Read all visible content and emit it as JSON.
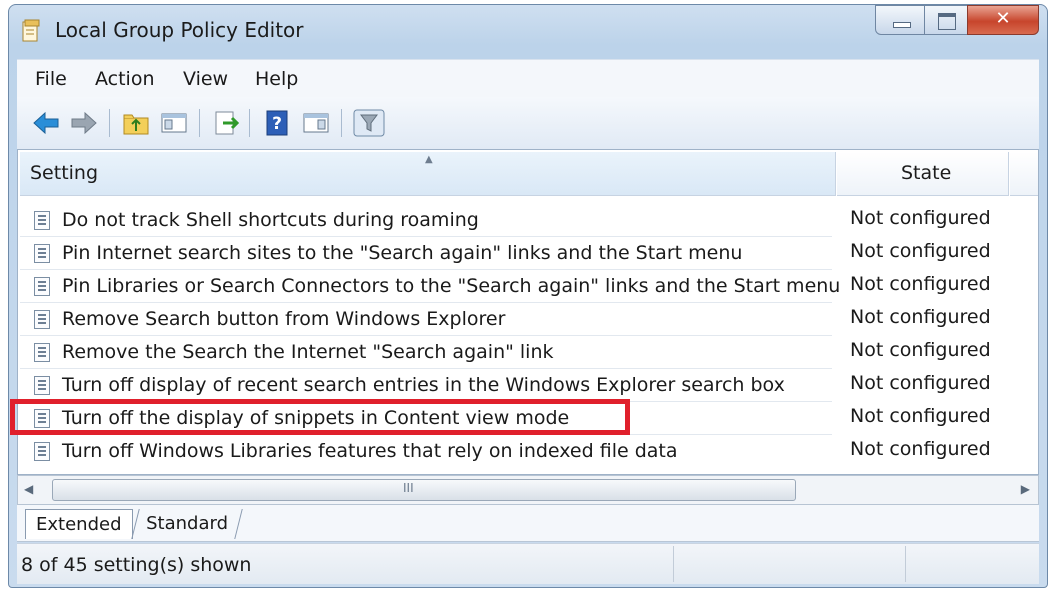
{
  "window": {
    "title": "Local Group Policy Editor",
    "caption_buttons": [
      "minimize-icon",
      "maximize-icon",
      "close-icon"
    ]
  },
  "menu": [
    "File",
    "Action",
    "View",
    "Help"
  ],
  "toolbar": {
    "buttons": [
      "back-arrow-icon",
      "forward-arrow-icon",
      "up-folder-icon",
      "show-hide-console-tree-icon",
      "export-list-icon",
      "help-icon",
      "show-hide-action-pane-icon",
      "filter-icon"
    ]
  },
  "table": {
    "columns": [
      "Setting",
      "State"
    ],
    "rows": [
      {
        "name": "Do not track Shell shortcuts during roaming",
        "state": "Not configured"
      },
      {
        "name": "Pin Internet search sites to the \"Search again\" links and the Start menu",
        "state": "Not configured"
      },
      {
        "name": "Pin Libraries or Search Connectors to the \"Search again\" links and the Start menu",
        "state": "Not configured"
      },
      {
        "name": "Remove Search button from Windows Explorer",
        "state": "Not configured"
      },
      {
        "name": "Remove the Search the Internet \"Search again\" link",
        "state": "Not configured"
      },
      {
        "name": "Turn off display of recent search entries in the Windows Explorer search box",
        "state": "Not configured"
      },
      {
        "name": "Turn off the display of snippets in Content view mode",
        "state": "Not configured"
      },
      {
        "name": "Turn off Windows Libraries features that rely on indexed file data",
        "state": "Not configured"
      }
    ],
    "highlighted_row": 6
  },
  "scrollbar": {
    "grip": "III"
  },
  "tabs": [
    "Extended",
    "Standard"
  ],
  "active_tab": "Extended",
  "status": {
    "text": "8 of 45 setting(s) shown"
  },
  "colors": {
    "highlight": "#e0202c",
    "titlebar": "#c9dbee",
    "close": "#c7452c"
  }
}
